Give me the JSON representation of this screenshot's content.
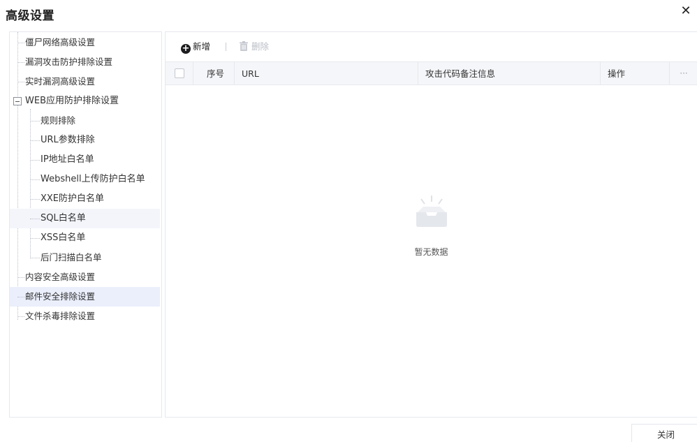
{
  "dialog": {
    "title": "高级设置",
    "close_glyph": "✕",
    "close_button": "关闭"
  },
  "tree": {
    "nodes": [
      {
        "label": "僵尸网络高级设置",
        "level": 1,
        "state": "normal"
      },
      {
        "label": "漏洞攻击防护排除设置",
        "level": 1,
        "state": "normal"
      },
      {
        "label": "实时漏洞高级设置",
        "level": 1,
        "state": "normal"
      },
      {
        "label": "WEB应用防护排除设置",
        "level": 1,
        "state": "expanded",
        "toggle": "minus"
      },
      {
        "label": "规则排除",
        "level": 2,
        "state": "normal"
      },
      {
        "label": "URL参数排除",
        "level": 2,
        "state": "normal"
      },
      {
        "label": "IP地址白名单",
        "level": 2,
        "state": "normal"
      },
      {
        "label": "Webshell上传防护白名单",
        "level": 2,
        "state": "normal"
      },
      {
        "label": "XXE防护白名单",
        "level": 2,
        "state": "normal"
      },
      {
        "label": "SQL白名单",
        "level": 2,
        "state": "hovered"
      },
      {
        "label": "XSS白名单",
        "level": 2,
        "state": "normal"
      },
      {
        "label": "后门扫描白名单",
        "level": 2,
        "state": "normal"
      },
      {
        "label": "内容安全高级设置",
        "level": 1,
        "state": "normal"
      },
      {
        "label": "邮件安全排除设置",
        "level": 1,
        "state": "selected"
      },
      {
        "label": "文件杀毒排除设置",
        "level": 1,
        "state": "normal"
      }
    ]
  },
  "toolbar": {
    "add_label": "新增",
    "add_icon": "plus-circle-icon",
    "delete_label": "删除",
    "delete_icon": "trash-icon",
    "delete_disabled": true
  },
  "table": {
    "columns": {
      "seq": "序号",
      "url": "URL",
      "remark": "攻击代码备注信息",
      "op": "操作",
      "more": "···"
    },
    "rows": []
  },
  "empty": {
    "text": "暂无数据",
    "icon": "empty-inbox-icon"
  },
  "colors": {
    "selected_bg": "#ebeffc",
    "header_bg": "#f5f6f9",
    "border": "#e5e8ee"
  }
}
